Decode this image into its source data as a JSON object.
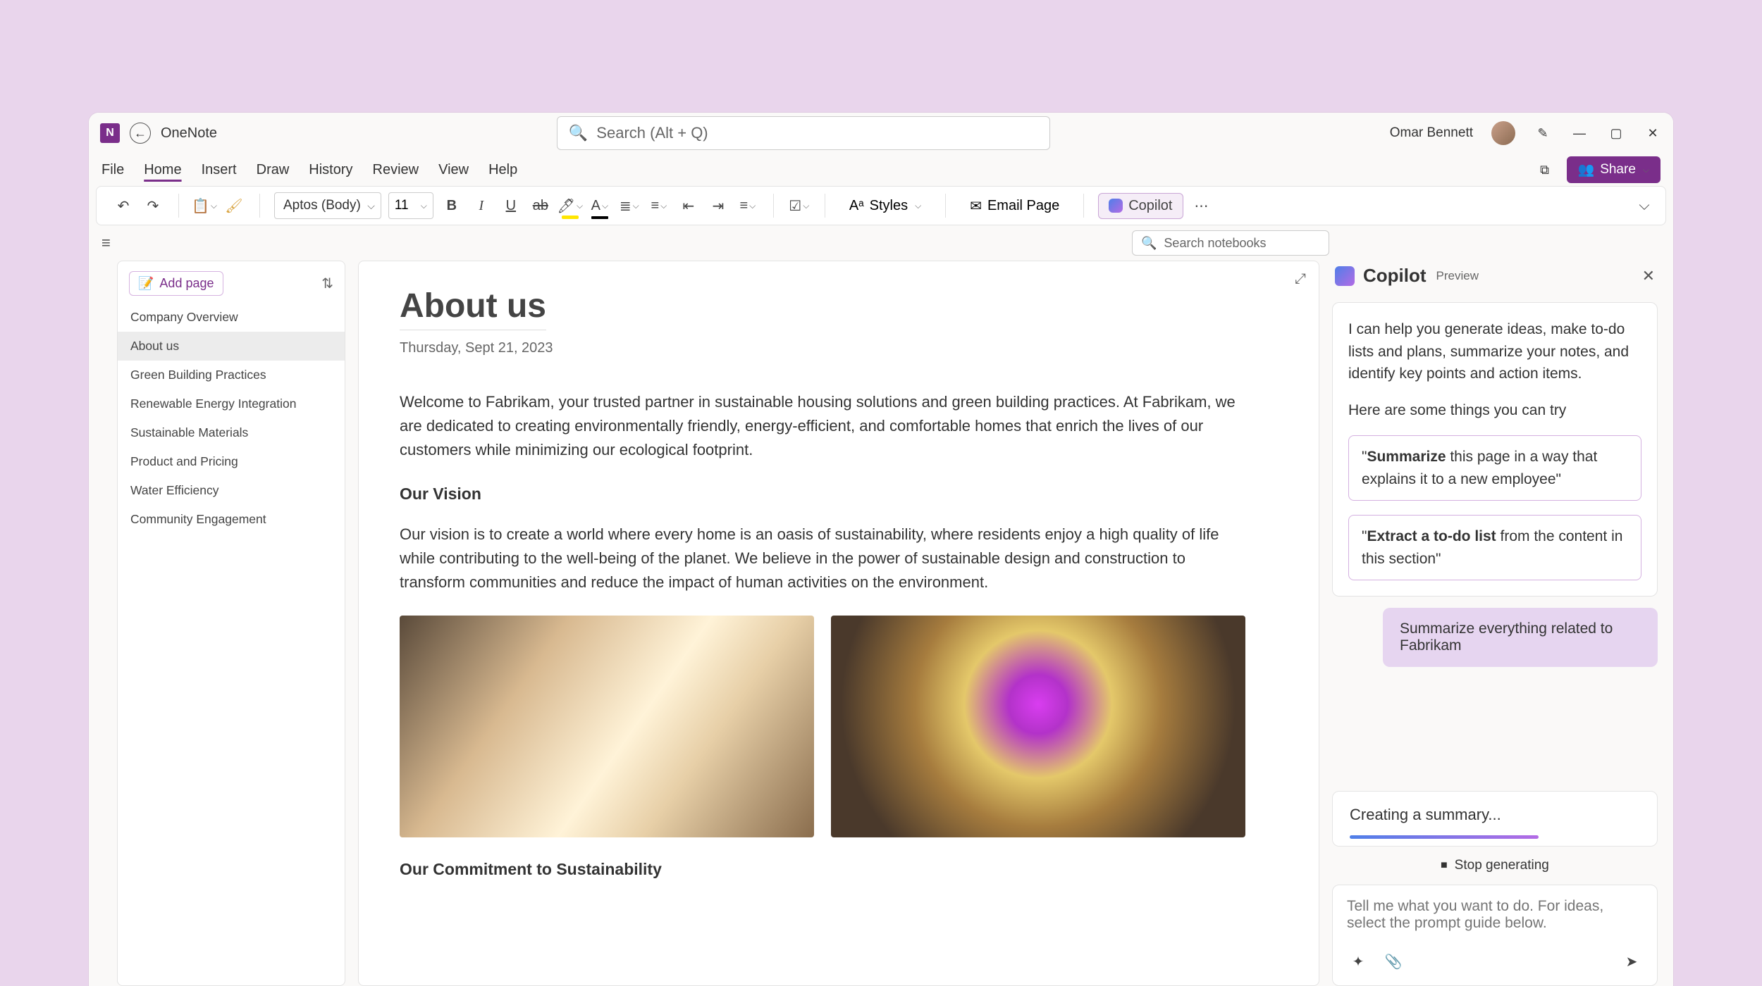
{
  "app": {
    "name": "OneNote",
    "icon_letter": "N"
  },
  "user": {
    "name": "Omar Bennett"
  },
  "search": {
    "placeholder": "Search (Alt + Q)"
  },
  "tabs": [
    "File",
    "Home",
    "Insert",
    "Draw",
    "History",
    "Review",
    "View",
    "Help"
  ],
  "active_tab_index": 1,
  "share_label": "Share",
  "toolbar": {
    "font": "Aptos (Body)",
    "size": "11",
    "styles_label": "Styles",
    "email_label": "Email Page",
    "copilot_label": "Copilot"
  },
  "search_notebooks_placeholder": "Search notebooks",
  "pagelist": {
    "add_label": "Add page",
    "items": [
      "Company Overview",
      "About us",
      "Green Building Practices",
      "Renewable Energy Integration",
      "Sustainable Materials",
      "Product and Pricing",
      "Water Efficiency",
      "Community Engagement"
    ],
    "active_index": 1
  },
  "document": {
    "title": "About us",
    "date": "Thursday, Sept 21, 2023",
    "intro": "Welcome to Fabrikam, your trusted partner in sustainable housing solutions and green building practices. At Fabrikam, we are dedicated to creating environmentally friendly, energy-efficient, and comfortable homes that enrich the lives of our customers while minimizing our ecological footprint.",
    "vision_heading": "Our Vision",
    "vision_body": "Our vision is to create a world where every home is an oasis of sustainability, where residents enjoy a high quality of life while contributing to the well-being of the planet. We believe in the power of sustainable design and construction to transform communities and reduce the impact of human activities on the environment.",
    "commitment_heading": "Our Commitment to Sustainability"
  },
  "copilot": {
    "title": "Copilot",
    "preview": "Preview",
    "intro": "I can help you generate ideas, make to-do lists and plans, summarize your notes, and identify key points and action items.",
    "try_label": "Here are some things you can try",
    "sugg1_bold": "Summarize",
    "sugg1_rest": " this page in a way that explains it to a new employee\"",
    "sugg1_quote": "\"",
    "sugg2_bold": "Extract a to-do list",
    "sugg2_rest": " from the content in this section\"",
    "user_msg": "Summarize everything related to Fabrikam",
    "progress": "Creating a summary...",
    "stop_label": "Stop generating",
    "input_placeholder": "Tell me what you want to do. For ideas, select the prompt guide below."
  }
}
